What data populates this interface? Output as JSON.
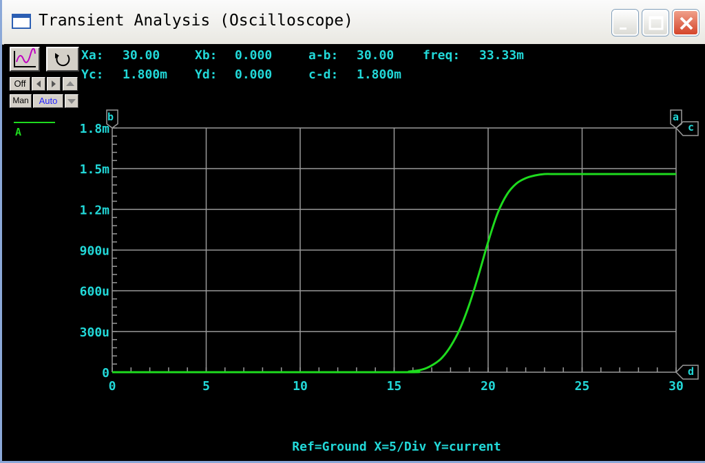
{
  "window": {
    "title": "Transient Analysis (Oscilloscope)"
  },
  "toolbar": {
    "off_label": "Off",
    "man_label": "Man",
    "auto_label": "Auto"
  },
  "readouts": {
    "xa_label": "Xa:",
    "xa_value": "30.00",
    "xb_label": "Xb:",
    "xb_value": "0.000",
    "ab_label": "a-b:",
    "ab_value": "30.00",
    "freq_label": "freq:",
    "freq_value": "33.33m",
    "yc_label": "Yc:",
    "yc_value": "1.800m",
    "yd_label": "Yd:",
    "yd_value": "0.000",
    "cd_label": "c-d:",
    "cd_value": "1.800m"
  },
  "legend": {
    "label": "A",
    "color": "#1edb1e"
  },
  "markers": {
    "a": "a",
    "b": "b",
    "c": "c",
    "d": "d"
  },
  "footer": "Ref=Ground  X=5/Div Y=current",
  "colors": {
    "trace": "#1edb1e",
    "grid": "#9a9a9a",
    "text": "#22d8d8",
    "background": "#000000"
  },
  "chart_data": {
    "type": "line",
    "xlim": [
      0,
      30
    ],
    "ylim": [
      0,
      0.0018
    ],
    "x_ticks": [
      "0",
      "5",
      "10",
      "15",
      "20",
      "25",
      "30"
    ],
    "y_ticks": [
      "0",
      "300u",
      "600u",
      "900u",
      "1.2m",
      "1.5m",
      "1.8m"
    ],
    "grid": true,
    "series": [
      {
        "name": "A",
        "x": [
          0,
          15,
          15.8,
          16.5,
          17,
          17.5,
          18,
          18.5,
          19,
          19.5,
          20,
          20.5,
          21,
          21.5,
          22,
          22.5,
          23,
          23.5,
          24,
          25,
          26,
          28,
          30
        ],
        "y": [
          0,
          0,
          5e-06,
          2e-05,
          5e-05,
          0.0001,
          0.00019,
          0.00032,
          0.0005,
          0.00072,
          0.00096,
          0.00117,
          0.00131,
          0.00139,
          0.00143,
          0.00145,
          0.00146,
          0.00146,
          0.00146,
          0.00146,
          0.00146,
          0.00146,
          0.00146
        ]
      }
    ]
  }
}
